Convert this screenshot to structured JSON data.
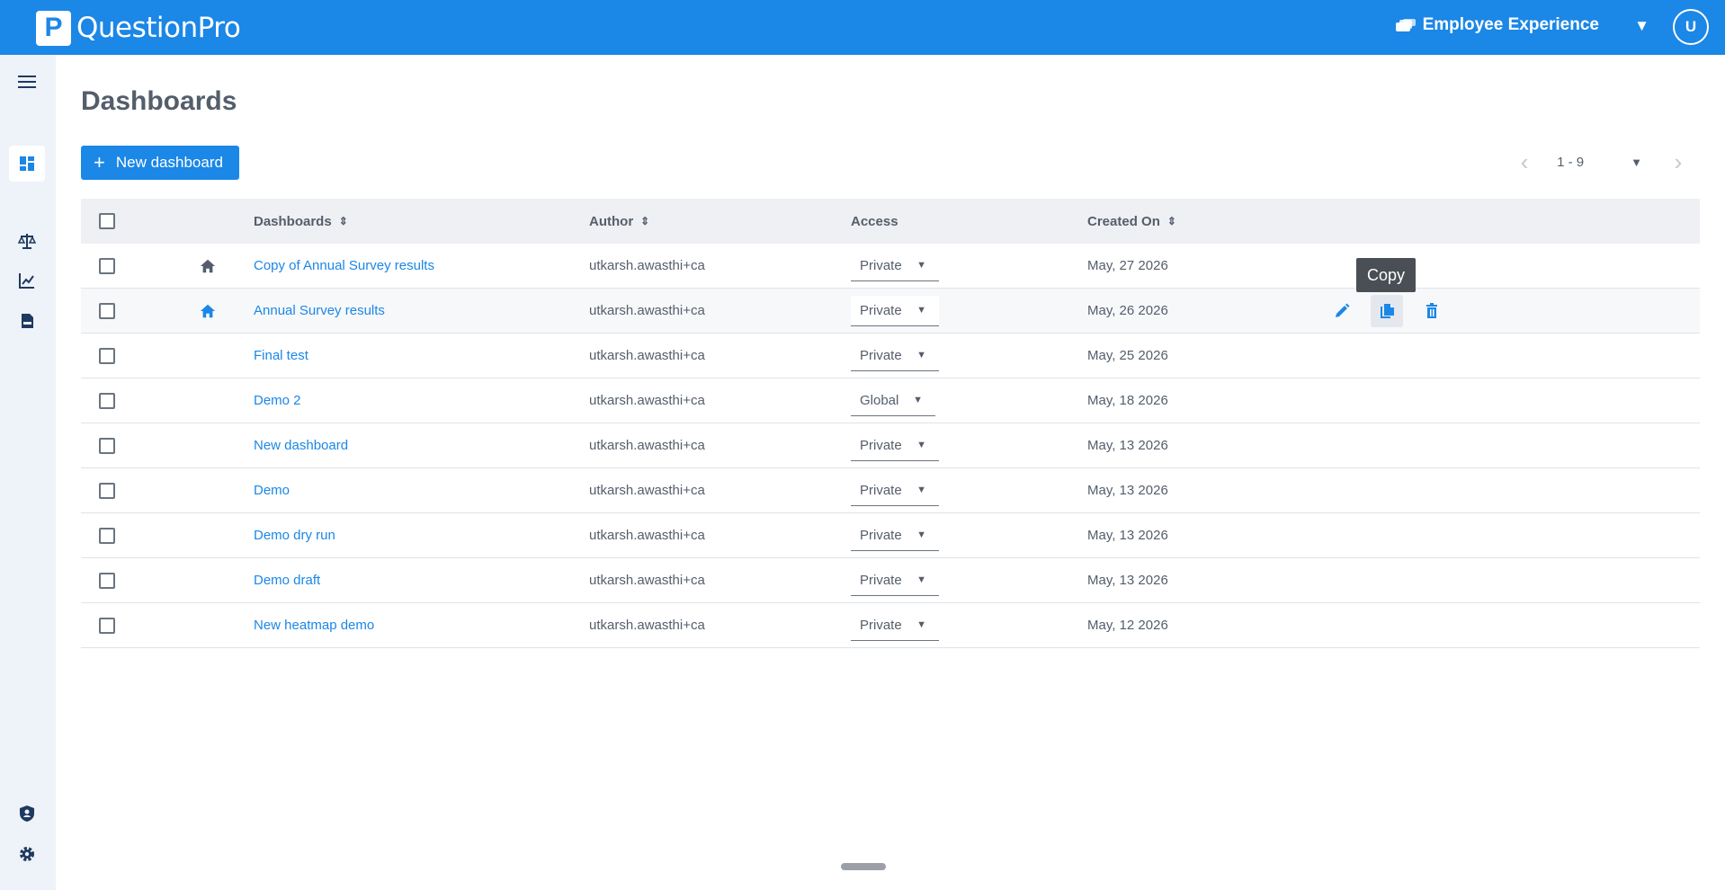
{
  "brand": {
    "logo_letter": "P",
    "name": "QuestionPro",
    "color": "#1b87e6"
  },
  "header": {
    "product": "Employee Experience",
    "avatar_initial": "U"
  },
  "sidebar": {
    "items": [
      {
        "name": "menu-icon"
      },
      {
        "name": "dashboard-icon",
        "active": true
      },
      {
        "name": "balance-scale-icon"
      },
      {
        "name": "trend-chart-icon"
      },
      {
        "name": "report-icon"
      },
      {
        "name": "shield-user-icon"
      },
      {
        "name": "gear-icon"
      }
    ]
  },
  "page": {
    "title": "Dashboards",
    "new_button": "New dashboard",
    "plus": "+"
  },
  "pager": {
    "range": "1 - 9"
  },
  "table": {
    "headers": {
      "name": "Dashboards",
      "author": "Author",
      "access": "Access",
      "created": "Created On"
    },
    "rows": [
      {
        "name": "Copy of Annual Survey results",
        "author": "utkarsh.awasthi+ca",
        "access": "Private",
        "created": "May, 27 2026",
        "home": "dark"
      },
      {
        "name": "Annual Survey results",
        "author": "utkarsh.awasthi+ca",
        "access": "Private",
        "created": "May, 26 2026",
        "home": "blue"
      },
      {
        "name": "Final test",
        "author": "utkarsh.awasthi+ca",
        "access": "Private",
        "created": "May, 25 2026"
      },
      {
        "name": "Demo 2",
        "author": "utkarsh.awasthi+ca",
        "access": "Global",
        "created": "May, 18 2026"
      },
      {
        "name": "New dashboard",
        "author": "utkarsh.awasthi+ca",
        "access": "Private",
        "created": "May, 13 2026"
      },
      {
        "name": "Demo",
        "author": "utkarsh.awasthi+ca",
        "access": "Private",
        "created": "May, 13 2026"
      },
      {
        "name": "Demo dry run",
        "author": "utkarsh.awasthi+ca",
        "access": "Private",
        "created": "May, 13 2026"
      },
      {
        "name": "Demo draft",
        "author": "utkarsh.awasthi+ca",
        "access": "Private",
        "created": "May, 13 2026"
      },
      {
        "name": "New heatmap demo",
        "author": "utkarsh.awasthi+ca",
        "access": "Private",
        "created": "May, 12 2026"
      }
    ]
  },
  "tooltip": {
    "text": "Copy"
  },
  "colors": {
    "accent": "#1b87e6",
    "text": "#545e6b",
    "sidebar_bg": "#eef2f9",
    "header_row_bg": "#eef0f3"
  }
}
